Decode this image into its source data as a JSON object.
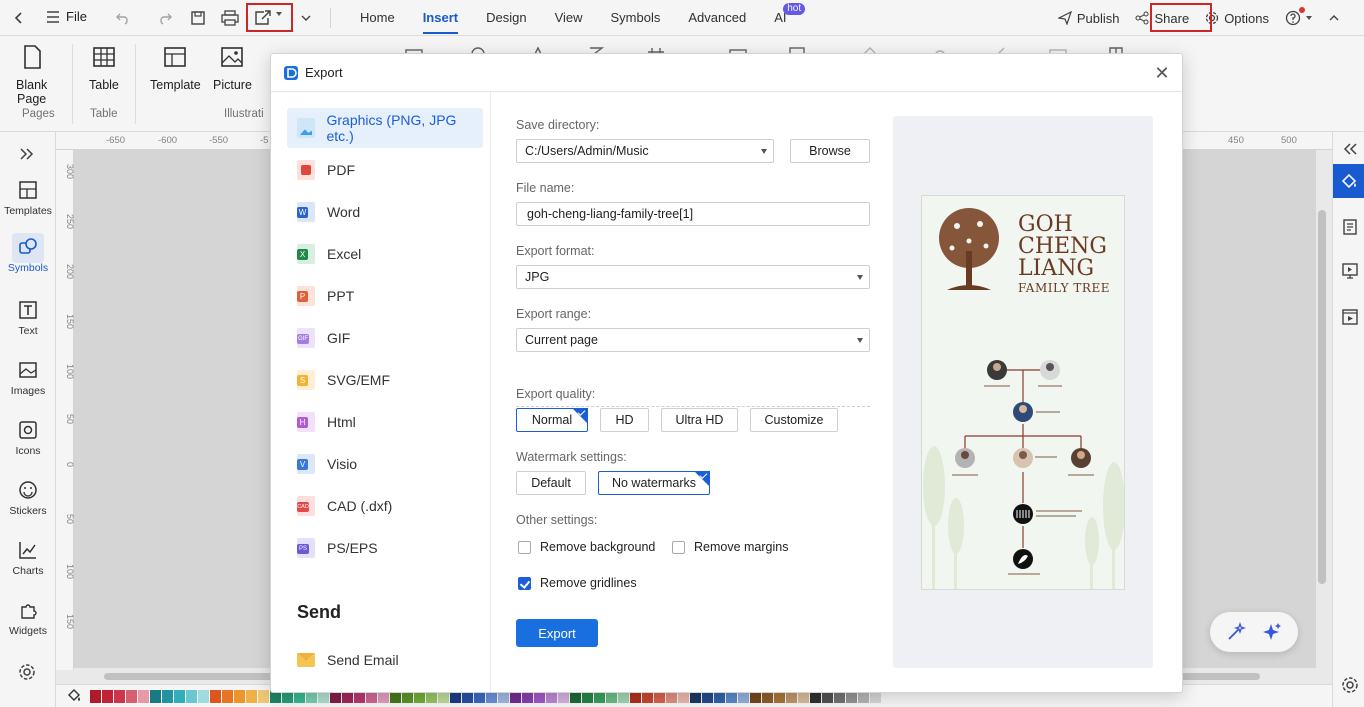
{
  "menubar": {
    "file_label": "File",
    "tabs": [
      {
        "label": "Home"
      },
      {
        "label": "Insert"
      },
      {
        "label": "Design"
      },
      {
        "label": "View"
      },
      {
        "label": "Symbols"
      },
      {
        "label": "Advanced"
      },
      {
        "label": "AI",
        "badge": "hot"
      }
    ],
    "publish_label": "Publish",
    "share_label": "Share",
    "options_label": "Options"
  },
  "ribbon": {
    "blank_page_label": "Blank\nPage",
    "blank_page_l1": "Blank",
    "blank_page_l2": "Page",
    "table_label": "Table",
    "template_label": "Template",
    "picture_label": "Picture",
    "groups": {
      "pages": "Pages",
      "table": "Table",
      "illustration": "Illustrati"
    }
  },
  "left_sidebar": [
    {
      "label": "Templates",
      "icon": "templates-icon"
    },
    {
      "label": "Symbols",
      "icon": "symbols-icon"
    },
    {
      "label": "Text",
      "icon": "text-icon"
    },
    {
      "label": "Images",
      "icon": "images-icon"
    },
    {
      "label": "Icons",
      "icon": "icons-icon"
    },
    {
      "label": "Stickers",
      "icon": "stickers-icon"
    },
    {
      "label": "Charts",
      "icon": "charts-icon"
    },
    {
      "label": "Widgets",
      "icon": "widgets-icon"
    }
  ],
  "ruler": {
    "h_ticks": [
      "-650",
      "-600",
      "-550",
      "-5"
    ],
    "h_ticks_right": [
      "450",
      "500"
    ],
    "v_ticks": [
      "300",
      "250",
      "200",
      "150",
      "100",
      "50",
      "0",
      "50",
      "100",
      "150"
    ]
  },
  "dialog": {
    "title": "Export",
    "formats": [
      {
        "label": "Graphics (PNG, JPG etc.)",
        "color": "#3aa3e8",
        "selected": true
      },
      {
        "label": "PDF",
        "color": "#e0463a"
      },
      {
        "label": "Word",
        "color": "#2b64c8"
      },
      {
        "label": "Excel",
        "color": "#1f8a47"
      },
      {
        "label": "PPT",
        "color": "#e0603a"
      },
      {
        "label": "GIF",
        "color": "#a57de0"
      },
      {
        "label": "SVG/EMF",
        "color": "#f2b233"
      },
      {
        "label": "Html",
        "color": "#b05ad8"
      },
      {
        "label": "Visio",
        "color": "#3a78d8"
      },
      {
        "label": "CAD (.dxf)",
        "color": "#e04a4a"
      },
      {
        "label": "PS/EPS",
        "color": "#6a5ad8"
      }
    ],
    "send_title": "Send",
    "send_email_label": "Send Email",
    "save_directory_label": "Save directory:",
    "save_directory_value": "C:/Users/Admin/Music",
    "browse_label": "Browse",
    "file_name_label": "File name:",
    "file_name_value": "goh-cheng-liang-family-tree[1]",
    "export_format_label": "Export format:",
    "export_format_value": "JPG",
    "export_range_label": "Export range:",
    "export_range_value": "Current page",
    "quality_label": "Export quality:",
    "quality_options": [
      {
        "label": "Normal",
        "selected": true
      },
      {
        "label": "HD"
      },
      {
        "label": "Ultra HD"
      },
      {
        "label": "Customize"
      }
    ],
    "watermark_label": "Watermark settings:",
    "watermark_options": [
      {
        "label": "Default"
      },
      {
        "label": "No watermarks",
        "selected": true
      }
    ],
    "other_label": "Other settings:",
    "remove_background_label": "Remove background",
    "remove_background_checked": false,
    "remove_margins_label": "Remove margins",
    "remove_margins_checked": false,
    "remove_gridlines_label": "Remove gridlines",
    "remove_gridlines_checked": true,
    "export_button_label": "Export",
    "preview": {
      "title_lines": [
        "GOH",
        "CHENG",
        "LIANG",
        "FAMILY TREE"
      ]
    }
  },
  "colors": {
    "accent": "#1a5ed8",
    "highlight_box": "#d62828",
    "palette": [
      "#b81d2e",
      "#c8243a",
      "#d7374f",
      "#e06377",
      "#f0a0ae",
      "#1b7f8a",
      "#239ba6",
      "#34b6c1",
      "#6fd0d8",
      "#a8e4e8",
      "#e45b1f",
      "#ef7a25",
      "#f59c2c",
      "#f6b94d",
      "#f8d27c",
      "#1e8b6a",
      "#28a57f",
      "#3bbf97",
      "#7dd5b8",
      "#b5e8d5",
      "#8a1f4a",
      "#a42b5c",
      "#bf3c73",
      "#d76d9a",
      "#eaa3c0",
      "#4b7d1f",
      "#5f9a28",
      "#77b53a",
      "#9dcd68",
      "#c5e2a0",
      "#1f3f8a",
      "#2a55ab",
      "#3b6fc9",
      "#6f97dd",
      "#a6bfea",
      "#7a2f9a",
      "#9041b6",
      "#a95ccd",
      "#c58ce0",
      "#dcb9ec",
      "#1e6f3a",
      "#2a8a4a",
      "#3aa55f",
      "#6fc48c",
      "#a8dcb9",
      "#b8321f",
      "#cf4a32",
      "#e0674e",
      "#eb9482",
      "#f3bfb3",
      "#1c3a6b",
      "#24508f",
      "#2f68b3",
      "#5f8fcf",
      "#98b7e2",
      "#7a4a1f",
      "#94602a",
      "#ad7a3c",
      "#c89c6a",
      "#dfc3a2",
      "#333333",
      "#555555",
      "#777777",
      "#999999",
      "#bbbbbb",
      "#dddddd"
    ]
  }
}
